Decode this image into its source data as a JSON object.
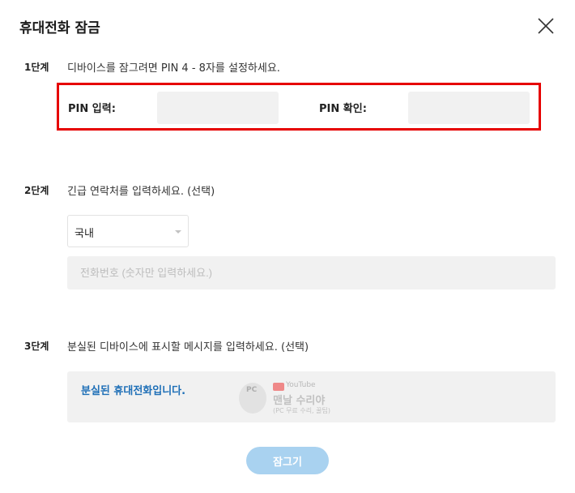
{
  "dialog": {
    "title": "휴대전화 잠금"
  },
  "step1": {
    "label": "1단계",
    "text": "디바이스를 잠그려면 PIN 4 - 8자를 설정하세요.",
    "pin_label": "PIN 입력:",
    "pin_confirm_label": "PIN 확인:",
    "highlight_color": "#e60000"
  },
  "step2": {
    "label": "2단계",
    "text": "긴급 연락처를 입력하세요. (선택)",
    "country_selected": "국내",
    "phone_placeholder": "전화번호 (숫자만 입력하세요.)"
  },
  "step3": {
    "label": "3단계",
    "text": "분실된 디바이스에 표시할 메시지를 입력하세요. (선택)",
    "message": "분실된 휴대전화입니다."
  },
  "watermark": {
    "logo_text": "PC",
    "platform": "YouTube",
    "channel": "맨날 수리야",
    "subtitle": "(PC 무료 수리, 꿀팁)"
  },
  "actions": {
    "lock_label": "잠그기"
  },
  "icons": {
    "close": "close-icon",
    "dropdown": "chevron-down-icon"
  }
}
